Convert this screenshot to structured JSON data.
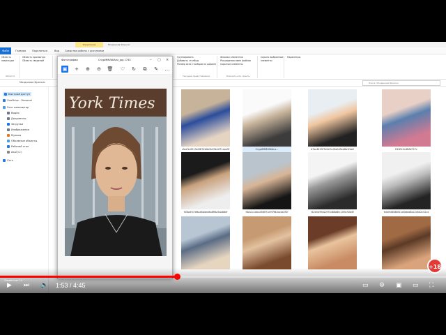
{
  "explorer": {
    "context_tab": "Управление",
    "window_title": "Мозданова Фрэнсис",
    "tabs": [
      "Файл",
      "Главная",
      "Поделиться",
      "Вид",
      "Средства работы с рисунками"
    ],
    "ribbon_groups": {
      "clipboard": {
        "lines": [
          "Область",
          "навигации"
        ],
        "label": "Области"
      },
      "panes": {
        "lines": [
          "Область просмотра",
          "Область сведений"
        ],
        "label": ""
      },
      "layout": {
        "lines": [
          "Огромные значки",
          "Мелкие значки",
          "Плитка"
        ],
        "label": "Структура"
      },
      "current": {
        "lines": [
          "Группировать",
          "Добавить столбцы",
          "Размер всех столбцов по ширине"
        ],
        "label": "Текущее представление"
      },
      "showhide": {
        "lines": [
          "Флажки элементов",
          "Расширения имен файлов",
          "Скрытые элементы"
        ],
        "label": "Показать или скрыть"
      },
      "hide": {
        "lines": [
          "Скрыть выбранные",
          "элементы"
        ],
        "label": ""
      },
      "options": {
        "lines": [
          "Параметры"
        ],
        "label": ""
      }
    },
    "address_path": "Мозданова Фрэнсис",
    "search_placeholder": "Поиск: Мозданова Фрэнсис",
    "sidebar": [
      {
        "label": "Быстрый доступ",
        "icon": "star-icon",
        "color": "#2b79d8"
      },
      {
        "label": "OneDrive - Personal",
        "icon": "cloud-icon",
        "color": "#2b79d8"
      },
      {
        "label": "Этот компьютер",
        "icon": "computer-icon",
        "color": "#4a9ee0"
      },
      {
        "label": "Видео",
        "icon": "video-icon",
        "color": "#6c7a89"
      },
      {
        "label": "Документы",
        "icon": "documents-icon",
        "color": "#6c7a89"
      },
      {
        "label": "Загрузки",
        "icon": "download-icon",
        "color": "#1a73e8"
      },
      {
        "label": "Изображения",
        "icon": "pictures-icon",
        "color": "#6c7a89"
      },
      {
        "label": "Музыка",
        "icon": "music-icon",
        "color": "#e07a2b"
      },
      {
        "label": "Объемные объекты",
        "icon": "3d-objects-icon",
        "color": "#4a9ee0"
      },
      {
        "label": "Рабочий стол",
        "icon": "desktop-icon",
        "color": "#2b79d8"
      },
      {
        "label": "Акаi (C:)",
        "icon": "drive-icon",
        "color": "#888888"
      },
      {
        "label": "Сеть",
        "icon": "network-icon",
        "color": "#2b79d8"
      }
    ],
    "thumbnails": [
      {
        "caption": "cfeaf1c8519e28f32b6e9b99b1671aae9f",
        "palette": [
          "#c6b39a",
          "#e6d4c3",
          "#2b4d9c"
        ]
      },
      {
        "caption": "Cnyp8MMVAKAnz...",
        "palette": [
          "#fafafa",
          "#3c3c3c",
          "#c9b59d"
        ],
        "selected": true
      },
      {
        "caption": "d7ac4429f7d2ef1c0fa0d5ed8a1fda5",
        "palette": [
          "#e9eef2",
          "#222222",
          "#f0c6a0"
        ]
      },
      {
        "caption": "E4fZrt2n4RAkT1Yc",
        "palette": [
          "#e8d0c6",
          "#d27a92",
          "#5b7fae"
        ]
      },
      {
        "caption": "f35bdf073f8a46bdee8b8ffda5ab880f",
        "palette": [
          "#1b1b1b",
          "#eeeeee",
          "#c9a27e"
        ]
      },
      {
        "caption": "f8cb1c1dbcd3f8f71e9f7f82bcbe2f2f",
        "palette": [
          "#b9c4cc",
          "#151515",
          "#d8b597"
        ]
      },
      {
        "caption": "f42e5499d22f75d86d8fc13f5c92b6f",
        "palette": [
          "#f4f4f4",
          "#2b2b2b",
          "#9a9a9a"
        ]
      },
      {
        "caption": "fe0e9d6680f21e8ebfa8bc2d5d2c52cd",
        "palette": [
          "#f0f0f0",
          "#242424",
          "#bcbcbc"
        ]
      },
      {
        "caption": "",
        "palette": [
          "#b8c6d4",
          "#e6d6c0",
          "#5a6c85"
        ]
      },
      {
        "caption": "",
        "palette": [
          "#c69a72",
          "#7a4a2e",
          "#e3c2a0"
        ]
      },
      {
        "caption": "",
        "palette": [
          "#6b3d28",
          "#c88b63",
          "#e9c49e"
        ]
      },
      {
        "caption": "",
        "palette": [
          "#a06a45",
          "#d9a37b",
          "#5b3a26"
        ]
      }
    ]
  },
  "viewer": {
    "app_title": "Фотографии",
    "file_name": "CnypMMVAKAnz_jpg",
    "count": "1745",
    "toolbar_icons": [
      "photo-icon",
      "add-icon",
      "zoom-in-icon",
      "zoom-out-icon",
      "delete-icon",
      "heart-icon",
      "rotate-icon",
      "crop-icon",
      "edit-icon",
      "more-icon"
    ],
    "sign_text": "York Times"
  },
  "video": {
    "time_current": "1:53",
    "time_total": "4:45",
    "progress": 0.397,
    "badge": "+18",
    "colors": {
      "progress": "#ff0000"
    }
  }
}
